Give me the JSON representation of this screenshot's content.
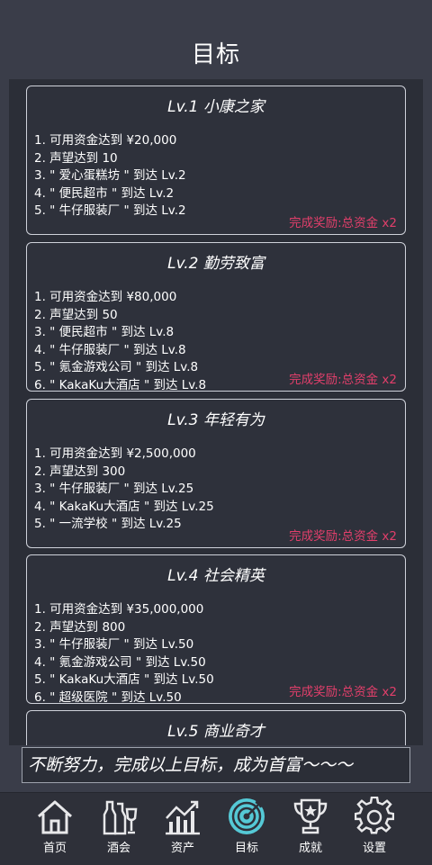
{
  "page": {
    "title": "目标"
  },
  "goals": [
    {
      "title": "Lv.1 小康之家",
      "items": [
        "1. 可用资金达到 ¥20,000",
        "2. 声望达到 10",
        "3. \" 爱心蛋糕坊 \" 到达 Lv.2",
        "4. \" 便民超市 \" 到达 Lv.2",
        "5. \" 牛仔服装厂 \" 到达 Lv.2"
      ],
      "reward": "完成奖励:总资金 x2"
    },
    {
      "title": "Lv.2 勤劳致富",
      "items": [
        "1. 可用资金达到 ¥80,000",
        "2. 声望达到 50",
        "3. \" 便民超市 \" 到达 Lv.8",
        "4. \" 牛仔服装厂 \" 到达 Lv.8",
        "5. \" 氪金游戏公司 \" 到达 Lv.8",
        "6. \" KakaKu大酒店 \" 到达 Lv.8"
      ],
      "reward": "完成奖励:总资金 x2"
    },
    {
      "title": "Lv.3 年轻有为",
      "items": [
        "1. 可用资金达到 ¥2,500,000",
        "2. 声望达到 300",
        "3. \" 牛仔服装厂 \" 到达 Lv.25",
        "4. \" KakaKu大酒店 \" 到达 Lv.25",
        "5. \" 一流学校 \" 到达 Lv.25"
      ],
      "reward": "完成奖励:总资金 x2"
    },
    {
      "title": "Lv.4 社会精英",
      "items": [
        "1. 可用资金达到 ¥35,000,000",
        "2. 声望达到 800",
        "3. \" 牛仔服装厂 \" 到达 Lv.50",
        "4. \" 氪金游戏公司 \" 到达 Lv.50",
        "5. \" KakaKu大酒店 \" 到达 Lv.50",
        "6. \" 超级医院 \" 到达 Lv.50"
      ],
      "reward": "完成奖励:总资金 x2"
    },
    {
      "title": "Lv.5 商业奇才",
      "items": [],
      "reward": ""
    }
  ],
  "banner": "不断努力，完成以上目标，成为首富～～～",
  "nav": [
    {
      "label": "首页",
      "icon": "home-icon"
    },
    {
      "label": "酒会",
      "icon": "bottles-icon"
    },
    {
      "label": "资产",
      "icon": "chart-icon"
    },
    {
      "label": "目标",
      "icon": "target-icon",
      "active": true
    },
    {
      "label": "成就",
      "icon": "trophy-icon"
    },
    {
      "label": "设置",
      "icon": "gear-icon"
    }
  ],
  "colors": {
    "background": "#3a3d49",
    "panel": "#2b2e37",
    "reward": "#e23f6b",
    "active": "#55c9d6"
  }
}
